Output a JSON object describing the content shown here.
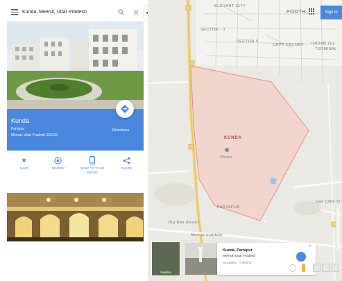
{
  "search": {
    "query": "Kunda, Meerut, Uttar Pradesh",
    "menu_icon": "menu-icon",
    "search_icon": "search-icon",
    "close_icon": "close-icon"
  },
  "place": {
    "name": "Kunda",
    "line1": "Partapur",
    "line2": "Meerut, Uttar Pradesh 250103",
    "directions_label": "Directions"
  },
  "actions": [
    {
      "label": "SAVE",
      "icon": "star-icon"
    },
    {
      "label": "NEARBY",
      "icon": "nearby-icon"
    },
    {
      "label": "SEND TO YOUR\nPHONE",
      "icon": "phone-icon"
    },
    {
      "label": "SHARE",
      "icon": "share-icon"
    }
  ],
  "map": {
    "labels": {
      "sushant_city": "SUSHANT CITY",
      "pooth": "POOTH",
      "sector3": "SECTOR - 3",
      "sector5": "SECTOR 5",
      "crpf": "CRPF COLONY",
      "indian_oil": "INDIAN OIL",
      "terminal": "TERMINAL",
      "kunda": "KUNDA",
      "partapur": "PARTAPUR",
      "big_bite": "Big Bite Resort",
      "meerut_institute": "Meerut Institute",
      "gail": "Gail CNG St",
      "sign_in": "Sign in",
      "dharti": "Dharti"
    },
    "accent": "#4a88e0",
    "polygon_fill": "#f4cfc7",
    "polygon_stroke": "#e89087"
  },
  "mini_card": {
    "name": "Kunda, Partapur",
    "sub": "Meerut, Uttar Pradesh",
    "coords": "28.938861, 77.669071",
    "satellite_label": "Satellite"
  }
}
